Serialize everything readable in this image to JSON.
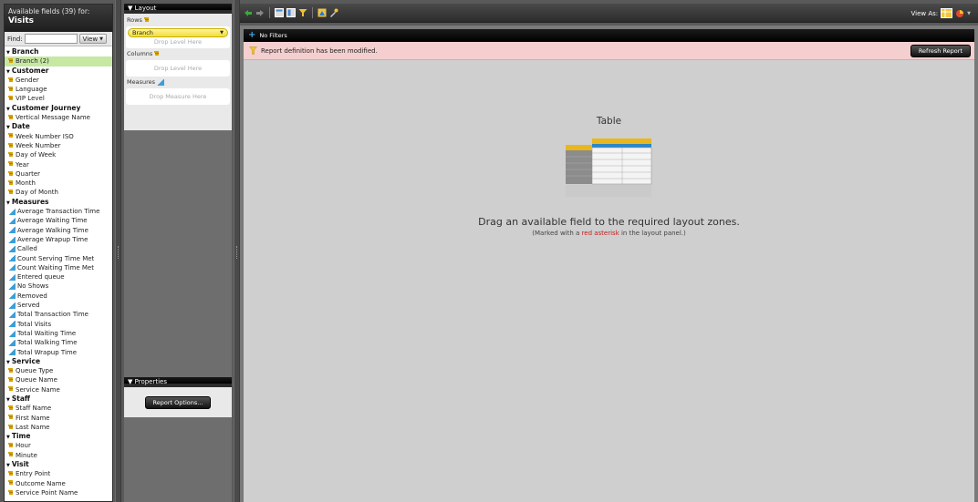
{
  "fields_panel": {
    "header_line1": "Available fields (39) for:",
    "header_line2": "Visits",
    "find_label": "Find:",
    "find_value": "",
    "view_label": "View",
    "groups": [
      {
        "name": "Branch",
        "items": [
          {
            "label": "Branch (2)",
            "kind": "dim",
            "selected": true
          }
        ]
      },
      {
        "name": "Customer",
        "items": [
          {
            "label": "Gender",
            "kind": "dim"
          },
          {
            "label": "Language",
            "kind": "dim"
          },
          {
            "label": "VIP Level",
            "kind": "dim"
          }
        ]
      },
      {
        "name": "Customer Journey",
        "items": [
          {
            "label": "Vertical Message Name",
            "kind": "dim"
          }
        ]
      },
      {
        "name": "Date",
        "items": [
          {
            "label": "Week Number ISO",
            "kind": "dim"
          },
          {
            "label": "Week Number",
            "kind": "dim"
          },
          {
            "label": "Day of Week",
            "kind": "dim"
          },
          {
            "label": "Year",
            "kind": "dim"
          },
          {
            "label": "Quarter",
            "kind": "dim"
          },
          {
            "label": "Month",
            "kind": "dim"
          },
          {
            "label": "Day of Month",
            "kind": "dim"
          }
        ]
      },
      {
        "name": "Measures",
        "items": [
          {
            "label": "Average Transaction Time",
            "kind": "measure"
          },
          {
            "label": "Average Waiting Time",
            "kind": "measure"
          },
          {
            "label": "Average Walking Time",
            "kind": "measure"
          },
          {
            "label": "Average Wrapup Time",
            "kind": "measure"
          },
          {
            "label": "Called",
            "kind": "measure"
          },
          {
            "label": "Count Serving Time Met",
            "kind": "measure"
          },
          {
            "label": "Count Waiting Time Met",
            "kind": "measure"
          },
          {
            "label": "Entered queue",
            "kind": "measure"
          },
          {
            "label": "No Shows",
            "kind": "measure"
          },
          {
            "label": "Removed",
            "kind": "measure"
          },
          {
            "label": "Served",
            "kind": "measure"
          },
          {
            "label": "Total Transaction Time",
            "kind": "measure"
          },
          {
            "label": "Total Visits",
            "kind": "measure"
          },
          {
            "label": "Total Waiting Time",
            "kind": "measure"
          },
          {
            "label": "Total Walking Time",
            "kind": "measure"
          },
          {
            "label": "Total Wrapup Time",
            "kind": "measure"
          }
        ]
      },
      {
        "name": "Service",
        "items": [
          {
            "label": "Queue Type",
            "kind": "dim"
          },
          {
            "label": "Queue Name",
            "kind": "dim"
          },
          {
            "label": "Service Name",
            "kind": "dim"
          }
        ]
      },
      {
        "name": "Staff",
        "items": [
          {
            "label": "Staff Name",
            "kind": "dim"
          },
          {
            "label": "First Name",
            "kind": "dim"
          },
          {
            "label": "Last Name",
            "kind": "dim"
          }
        ]
      },
      {
        "name": "Time",
        "items": [
          {
            "label": "Hour",
            "kind": "dim"
          },
          {
            "label": "Minute",
            "kind": "dim"
          }
        ]
      },
      {
        "name": "Visit",
        "items": [
          {
            "label": "Entry Point",
            "kind": "dim"
          },
          {
            "label": "Outcome Name",
            "kind": "dim"
          },
          {
            "label": "Service Point Name",
            "kind": "dim"
          }
        ]
      }
    ]
  },
  "layout_panel": {
    "title": "Layout",
    "rows_label": "Rows",
    "rows_field": "Branch",
    "rows_drop": "Drop Level Here",
    "columns_label": "Columns",
    "columns_drop": "Drop Level Here",
    "measures_label": "Measures",
    "measures_drop": "Drop Measure Here"
  },
  "properties_panel": {
    "title": "Properties",
    "options_button": "Report Options..."
  },
  "toolbar": {
    "view_as_label": "View As:"
  },
  "main": {
    "filters_label": "No Filters",
    "notice": "Report definition has been modified.",
    "refresh_button": "Refresh Report",
    "table_label": "Table",
    "drag_message": "Drag an available field to the required layout zones.",
    "marked_prefix": "(Marked with a ",
    "marked_red": "red asterisk",
    "marked_suffix": " in the layout panel.)"
  },
  "colors": {
    "selected_field_bg": "#c7e8a3",
    "notice_bg": "#f5cfcf",
    "accent_blue": "#43a4e8",
    "asterisk_red": "#c41e1e"
  }
}
